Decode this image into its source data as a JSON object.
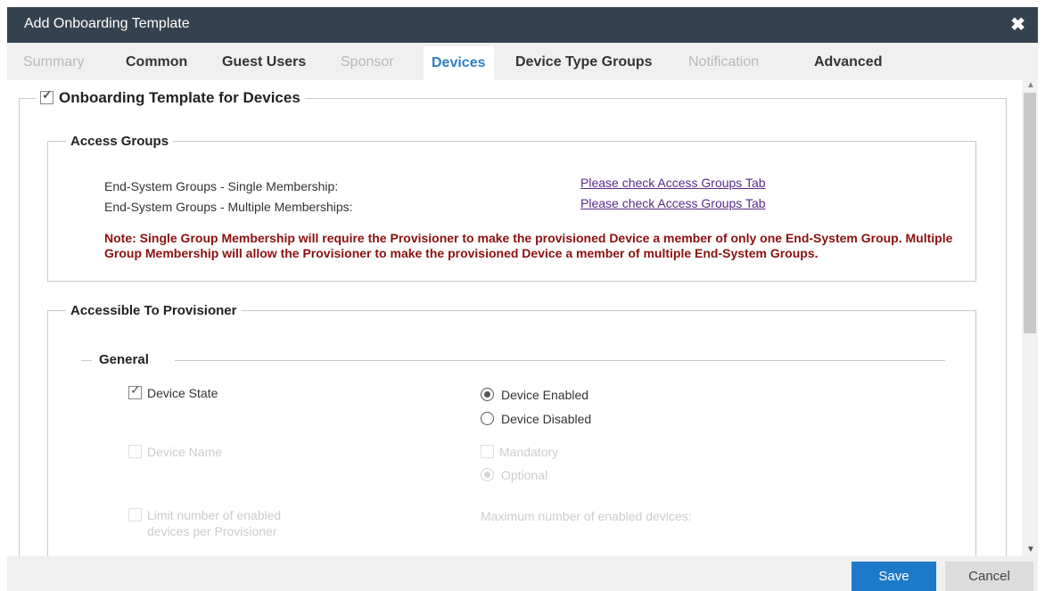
{
  "window": {
    "title": "Add Onboarding Template",
    "close_icon": "close-icon"
  },
  "tabs": [
    {
      "label": "Summary",
      "state": "disabled"
    },
    {
      "label": "Common",
      "state": "normal"
    },
    {
      "label": "Guest Users",
      "state": "normal"
    },
    {
      "label": "Sponsor",
      "state": "disabled"
    },
    {
      "label": "Devices",
      "state": "active"
    },
    {
      "label": "Device Type Groups",
      "state": "normal"
    },
    {
      "label": "Notification",
      "state": "disabled"
    },
    {
      "label": "Advanced",
      "state": "normal"
    }
  ],
  "devices": {
    "template_label": "Onboarding Template for Devices",
    "template_checked": true,
    "access_groups": {
      "legend": "Access Groups",
      "single_label": "End-System Groups - Single Membership:",
      "single_link": "Please check Access Groups Tab",
      "multiple_label": "End-System Groups - Multiple Memberships:",
      "multiple_link": "Please check Access Groups Tab",
      "note": "Note: Single Group Membership will require the Provisioner to make the provisioned Device a member of only one End-System Group. Multiple Group Membership will allow the Provisioner to make the provisioned Device a member of multiple End-System Groups."
    },
    "provisioner": {
      "legend": "Accessible To Provisioner",
      "general": {
        "legend": "General",
        "device_state_label": "Device State",
        "device_state_checked": true,
        "enabled_label": "Device Enabled",
        "disabled_label": "Device Disabled",
        "device_name_label": "Device Name",
        "mandatory_label": "Mandatory",
        "optional_label": "Optional",
        "limit_label_line1": "Limit number of enabled",
        "limit_label_line2": "devices per Provisioner",
        "max_label": "Maximum number of enabled devices:"
      }
    }
  },
  "footer": {
    "save_label": "Save",
    "cancel_label": "Cancel"
  },
  "colors": {
    "titlebar": "#34424f",
    "active_tab": "#2f7fc5",
    "save": "#1d7ac9",
    "note": "#8b1010"
  }
}
